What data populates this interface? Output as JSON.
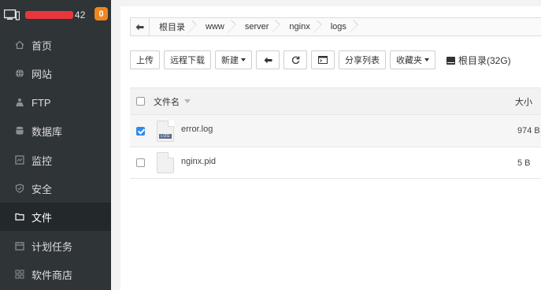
{
  "sidebar": {
    "host_suffix": "42",
    "badge": "0",
    "items": [
      {
        "icon": "home-icon",
        "label": "首页"
      },
      {
        "icon": "globe-icon",
        "label": "网站"
      },
      {
        "icon": "ftp-icon",
        "label": "FTP"
      },
      {
        "icon": "database-icon",
        "label": "数据库"
      },
      {
        "icon": "monitor-icon",
        "label": "监控"
      },
      {
        "icon": "shield-icon",
        "label": "安全"
      },
      {
        "icon": "folder-icon",
        "label": "文件",
        "active": true
      },
      {
        "icon": "calendar-icon",
        "label": "计划任务"
      },
      {
        "icon": "grid-icon",
        "label": "软件商店"
      }
    ]
  },
  "breadcrumb": [
    "根目录",
    "www",
    "server",
    "nginx",
    "logs"
  ],
  "toolbar": {
    "upload": "上传",
    "remote_download": "远程下载",
    "new": "新建",
    "share_list": "分享列表",
    "favorites": "收藏夹",
    "disk": "根目录(32G)"
  },
  "table": {
    "col_name": "文件名",
    "col_size": "大小",
    "rows": [
      {
        "name": "error.log",
        "size": "974 B",
        "checked": true,
        "icon_tag": "LOG"
      },
      {
        "name": "nginx.pid",
        "size": "5 B",
        "checked": false
      }
    ]
  },
  "colors": {
    "sidebar_bg": "#2f3437",
    "sidebar_active": "#23282b",
    "badge": "#f0861f",
    "checkbox": "#2d8cf0"
  }
}
